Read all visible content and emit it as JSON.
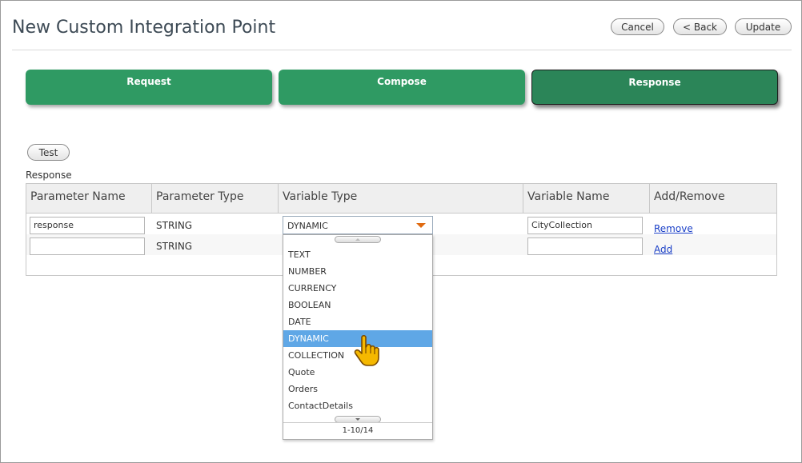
{
  "header": {
    "title": "New Custom Integration Point",
    "cancel_label": "Cancel",
    "back_label": "< Back",
    "update_label": "Update"
  },
  "tabs": [
    {
      "label": "Request"
    },
    {
      "label": "Compose"
    },
    {
      "label": "Response",
      "active": true
    }
  ],
  "test_label": "Test",
  "section_label": "Response",
  "table": {
    "columns": [
      "Parameter Name",
      "Parameter Type",
      "Variable Type",
      "Variable Name",
      "Add/Remove"
    ],
    "rows": [
      {
        "param_name": "response",
        "param_type": "STRING",
        "variable_type": "DYNAMIC",
        "variable_name": "CityCollection",
        "action": "Remove"
      },
      {
        "param_name": "",
        "param_type": "STRING",
        "variable_type": "",
        "variable_name": "",
        "action": "Add"
      }
    ]
  },
  "dropdown": {
    "options": [
      "TEXT",
      "NUMBER",
      "CURRENCY",
      "BOOLEAN",
      "DATE",
      "DYNAMIC",
      "COLLECTION",
      "Quote",
      "Orders",
      "ContactDetails"
    ],
    "selected": "DYNAMIC",
    "pager": "1-10/14"
  },
  "colors": {
    "tab_green": "#2f9a63",
    "selected_option": "#5fa7e6",
    "caret": "#e06a10",
    "link": "#1a3fc7"
  }
}
